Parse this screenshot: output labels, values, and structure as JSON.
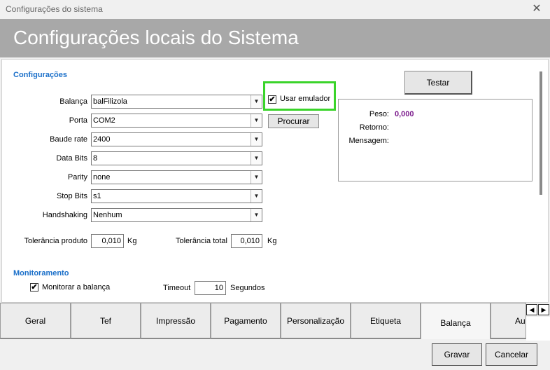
{
  "window": {
    "title": "Configurações do sistema",
    "close_glyph": "✕"
  },
  "banner": {
    "title": "Configurações locais do Sistema"
  },
  "config": {
    "section_title": "Configurações",
    "fields": {
      "balanca": {
        "label": "Balança",
        "value": "balFilizola"
      },
      "porta": {
        "label": "Porta",
        "value": "COM2"
      },
      "baude_rate": {
        "label": "Baude rate",
        "value": "2400"
      },
      "data_bits": {
        "label": "Data Bits",
        "value": "8"
      },
      "parity": {
        "label": "Parity",
        "value": "none"
      },
      "stop_bits": {
        "label": "Stop Bits",
        "value": "s1"
      },
      "handshaking": {
        "label": "Handshaking",
        "value": "Nenhum"
      }
    },
    "usar_emulador": {
      "label": "Usar emulador",
      "checked": true
    },
    "procurar_label": "Procurar",
    "tolerancia_produto": {
      "label": "Tolerância produto",
      "value": "0,010",
      "unit": "Kg"
    },
    "tolerancia_total": {
      "label": "Tolerância total",
      "value": "0,010",
      "unit": "Kg"
    },
    "dropdown_arrow": "▼",
    "check_glyph": "✔"
  },
  "test": {
    "button_label": "Testar",
    "peso_label": "Peso:",
    "peso_value": "0,000",
    "peso_color": "#7b1a8c",
    "retorno_label": "Retorno:",
    "mensagem_label": "Mensagem:"
  },
  "monitoramento": {
    "section_title": "Monitoramento",
    "monitorar_label": "Monitorar a balança",
    "monitorar_checked": true,
    "timeout_label": "Timeout",
    "timeout_value": "10",
    "timeout_unit": "Segundos"
  },
  "tabs": [
    {
      "label": "Geral",
      "active": false
    },
    {
      "label": "Tef",
      "active": false
    },
    {
      "label": "Impressão",
      "active": false
    },
    {
      "label": "Pagamento",
      "active": false
    },
    {
      "label": "Personalização",
      "active": false
    },
    {
      "label": "Etiqueta",
      "active": false
    },
    {
      "label": "Balança",
      "active": true
    },
    {
      "label": "Au",
      "active": false
    }
  ],
  "tab_scroll": {
    "left": "◀",
    "right": "▶"
  },
  "footer": {
    "gravar_label": "Gravar",
    "cancelar_label": "Cancelar"
  },
  "colors": {
    "accent": "#1a6fc9",
    "highlight_border": "#3ad42a",
    "banner": "#a8a8a8"
  }
}
